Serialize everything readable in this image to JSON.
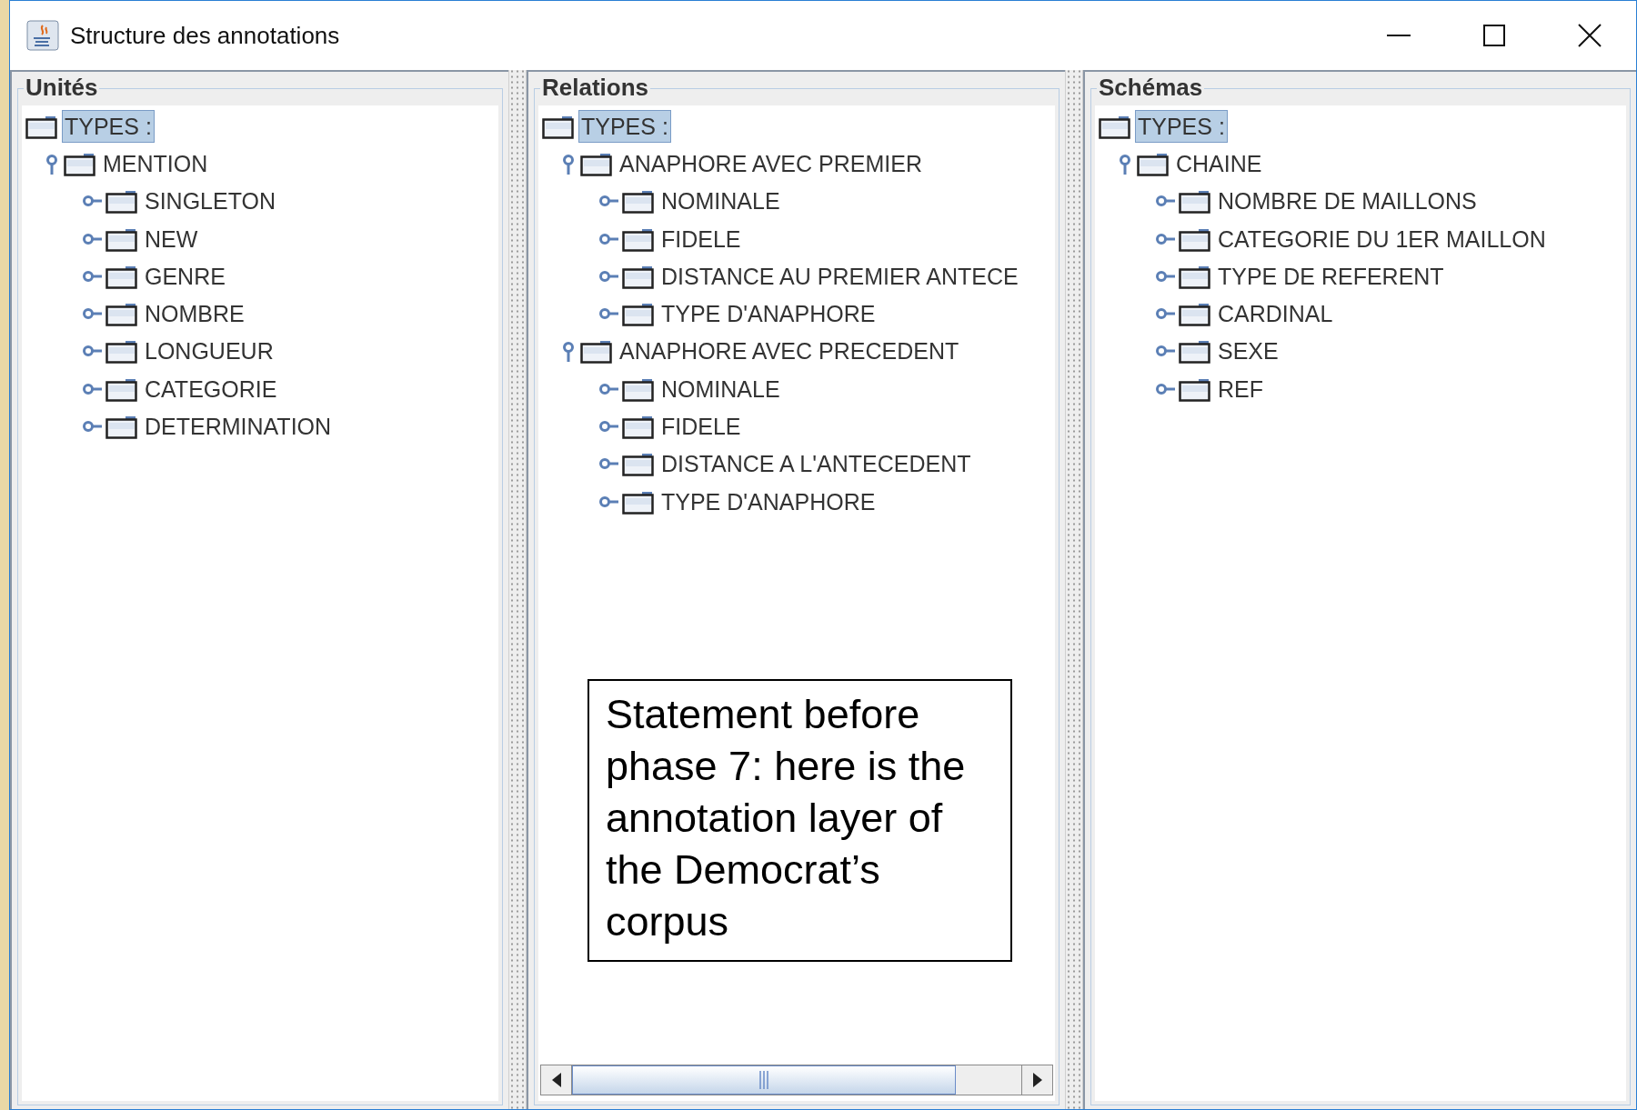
{
  "window": {
    "title": "Structure des annotations"
  },
  "panels": [
    {
      "title": "Unités",
      "horizontal_scrollbar": false,
      "tree": {
        "label": "TYPES :",
        "selected": true,
        "children": [
          {
            "label": "MENTION",
            "expanded": true,
            "selected": false,
            "children": [
              {
                "label": "SINGLETON",
                "expanded": false,
                "selected": false
              },
              {
                "label": "NEW",
                "expanded": false,
                "selected": false
              },
              {
                "label": "GENRE",
                "expanded": false,
                "selected": false
              },
              {
                "label": "NOMBRE",
                "expanded": false,
                "selected": false
              },
              {
                "label": "LONGUEUR",
                "expanded": false,
                "selected": false
              },
              {
                "label": "CATEGORIE",
                "expanded": false,
                "selected": false
              },
              {
                "label": "DETERMINATION",
                "expanded": false,
                "selected": false
              }
            ]
          }
        ]
      }
    },
    {
      "title": "Relations",
      "horizontal_scrollbar": true,
      "tree": {
        "label": "TYPES :",
        "selected": true,
        "children": [
          {
            "label": "ANAPHORE AVEC PREMIER",
            "expanded": true,
            "selected": false,
            "children": [
              {
                "label": "NOMINALE",
                "expanded": false,
                "selected": false
              },
              {
                "label": "FIDELE",
                "expanded": false,
                "selected": false
              },
              {
                "label": "DISTANCE AU PREMIER ANTECE",
                "expanded": false,
                "selected": false
              },
              {
                "label": "TYPE D'ANAPHORE",
                "expanded": false,
                "selected": false
              }
            ]
          },
          {
            "label": "ANAPHORE AVEC PRECEDENT",
            "expanded": true,
            "selected": false,
            "children": [
              {
                "label": "NOMINALE",
                "expanded": false,
                "selected": false
              },
              {
                "label": "FIDELE",
                "expanded": false,
                "selected": false
              },
              {
                "label": "DISTANCE A L'ANTECEDENT",
                "expanded": false,
                "selected": false
              },
              {
                "label": "TYPE D'ANAPHORE",
                "expanded": false,
                "selected": false
              }
            ]
          }
        ]
      }
    },
    {
      "title": "Schémas",
      "horizontal_scrollbar": false,
      "tree": {
        "label": "TYPES :",
        "selected": true,
        "children": [
          {
            "label": "CHAINE",
            "expanded": true,
            "selected": false,
            "children": [
              {
                "label": "NOMBRE DE MAILLONS",
                "expanded": false,
                "selected": false
              },
              {
                "label": "CATEGORIE DU 1ER MAILLON",
                "expanded": false,
                "selected": false
              },
              {
                "label": "TYPE DE REFERENT",
                "expanded": false,
                "selected": false
              },
              {
                "label": "CARDINAL",
                "expanded": false,
                "selected": false
              },
              {
                "label": "SEXE",
                "expanded": false,
                "selected": false
              },
              {
                "label": "REF",
                "expanded": false,
                "selected": false
              }
            ]
          }
        ]
      }
    }
  ],
  "note": {
    "text": "Statement before phase 7: here is the annotation layer of the Democrat’s corpus"
  }
}
